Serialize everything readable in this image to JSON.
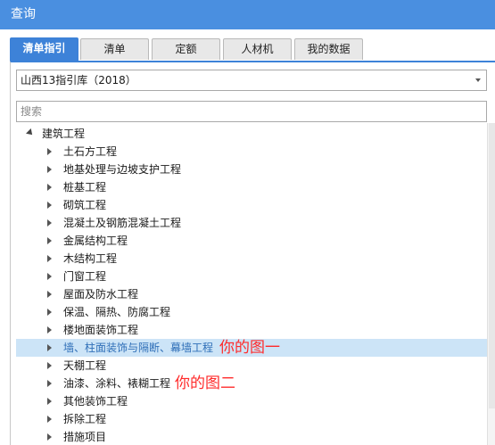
{
  "window": {
    "title": "查询"
  },
  "tabs": [
    {
      "label": "清单指引",
      "active": true
    },
    {
      "label": "清单",
      "active": false
    },
    {
      "label": "定额",
      "active": false
    },
    {
      "label": "人材机",
      "active": false
    },
    {
      "label": "我的数据",
      "active": false
    }
  ],
  "library_select": {
    "value": "山西13指引库（2018）"
  },
  "search": {
    "placeholder": "搜索"
  },
  "tree": {
    "root": {
      "label": "建筑工程",
      "icon": "expanded-triangle-icon"
    },
    "children": [
      {
        "label": "土石方工程"
      },
      {
        "label": "地基处理与边坡支护工程"
      },
      {
        "label": "桩基工程"
      },
      {
        "label": "砌筑工程"
      },
      {
        "label": "混凝土及钢筋混凝土工程"
      },
      {
        "label": "金属结构工程"
      },
      {
        "label": "木结构工程"
      },
      {
        "label": "门窗工程"
      },
      {
        "label": "屋面及防水工程"
      },
      {
        "label": "保温、隔热、防腐工程"
      },
      {
        "label": "楼地面装饰工程"
      },
      {
        "label": "墙、柱面装饰与隔断、幕墙工程",
        "selected": true,
        "note": "你的图一"
      },
      {
        "label": "天棚工程"
      },
      {
        "label": "油漆、涂料、裱糊工程",
        "note": "你的图二"
      },
      {
        "label": "其他装饰工程"
      },
      {
        "label": "拆除工程"
      },
      {
        "label": "措施项目"
      }
    ]
  },
  "colors": {
    "titlebar": "#4a8fe0",
    "active_tab": "#3d82d8",
    "selection": "#cce4f7",
    "annotation": "#ff2b2b"
  }
}
